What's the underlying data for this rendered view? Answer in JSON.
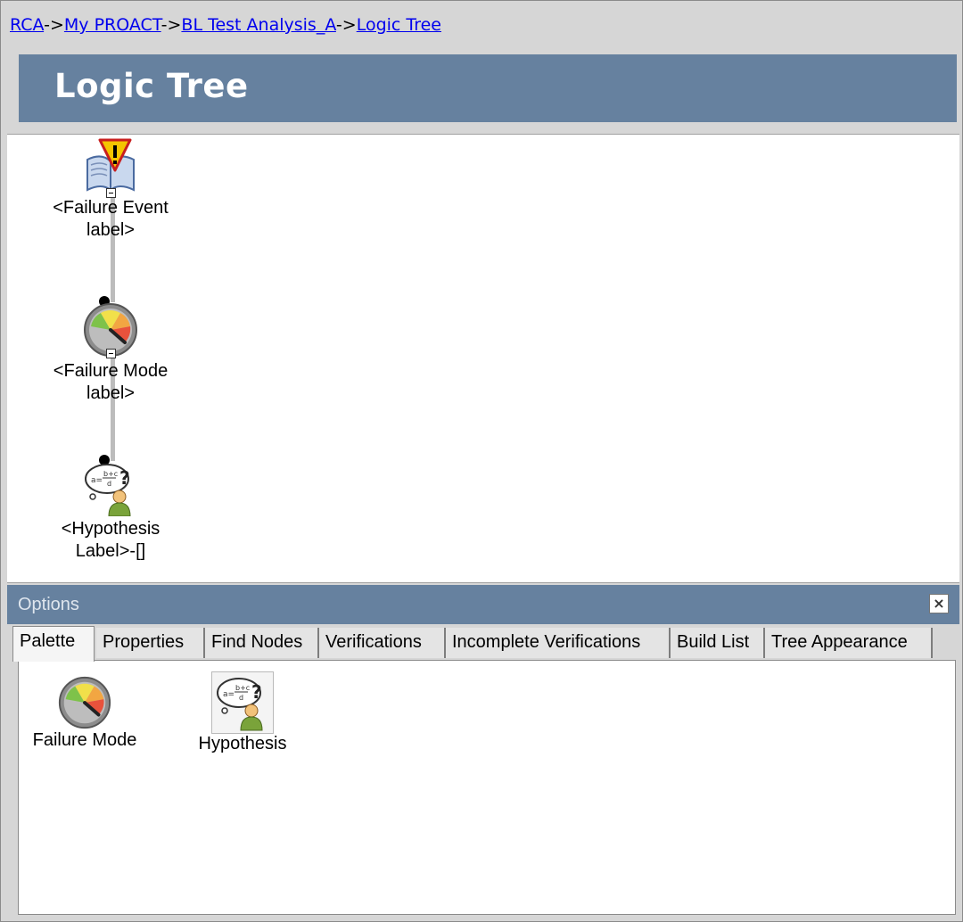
{
  "breadcrumb": {
    "items": [
      "RCA",
      "My PROACT",
      "BL Test Analysis_A",
      "Logic Tree"
    ],
    "separator": "->"
  },
  "header": {
    "title": "Logic Tree"
  },
  "tree": {
    "nodes": [
      {
        "type": "Failure Event",
        "label_line1": "<Failure Event",
        "label_line2": "label>",
        "icon": "failure-event-icon"
      },
      {
        "type": "Failure Mode",
        "label_line1": "<Failure Mode",
        "label_line2": "label>",
        "icon": "failure-mode-icon"
      },
      {
        "type": "Hypothesis",
        "label_line1": "<Hypothesis",
        "label_line2": "Label>-[]",
        "icon": "hypothesis-icon"
      }
    ]
  },
  "options": {
    "title": "Options",
    "close_label": "×",
    "tabs": [
      {
        "label": "Palette",
        "active": true
      },
      {
        "label": "Properties"
      },
      {
        "label": "Find Nodes"
      },
      {
        "label": "Verifications"
      },
      {
        "label": "Incomplete Verifications"
      },
      {
        "label": "Build List"
      },
      {
        "label": "Tree Appearance"
      }
    ],
    "palette_items": [
      {
        "label": "Failure Mode",
        "icon": "failure-mode-icon"
      },
      {
        "label": "Hypothesis",
        "icon": "hypothesis-icon"
      }
    ]
  },
  "colors": {
    "banner": "#66819f",
    "link": "#0000ee",
    "warning": "#f4c400"
  }
}
